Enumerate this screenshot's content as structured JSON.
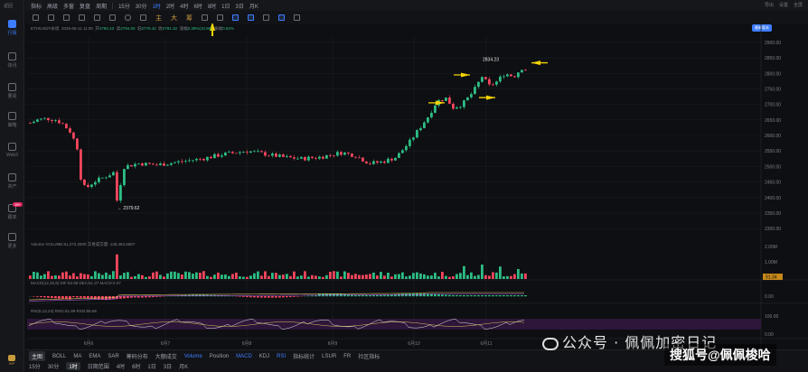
{
  "sidebar": {
    "top_label": "返回",
    "items": [
      {
        "label": "行情",
        "icon": "chart-bar-icon",
        "active": true
      },
      {
        "label": "快讯",
        "icon": "news-icon"
      },
      {
        "label": "要闻",
        "icon": "newspaper-icon"
      },
      {
        "label": "策略",
        "icon": "strategy-icon"
      },
      {
        "label": "Web3",
        "icon": "web3-icon"
      },
      {
        "label": "资产",
        "icon": "wallet-icon"
      },
      {
        "label": "跟单",
        "icon": "copy-trade-icon",
        "badge": "99+"
      },
      {
        "label": "更多",
        "icon": "grid-icon"
      }
    ],
    "vip_label": "VIP"
  },
  "toolbar": {
    "items": [
      "指标",
      "高级",
      "多窗",
      "复盘",
      "周期",
      "15分",
      "30分",
      "1时",
      "2时",
      "4时",
      "6时",
      "8时",
      "1日",
      "3日",
      "月K"
    ],
    "active": "1时"
  },
  "drawbar": {
    "text_tools": [
      "主",
      "大",
      "筹"
    ]
  },
  "right_tools": [
    "导出",
    "设置",
    "全屏"
  ],
  "download_btn": "最新版本",
  "legend": {
    "symbol": "ETH/USDT永续",
    "time": "2025-06-11 11:00",
    "open_label": "开",
    "open": "2780.43",
    "high_label": "高",
    "high": "2794.00",
    "low_label": "低",
    "low": "2779.42",
    "close_label": "收",
    "close": "2791.32",
    "change_label": "涨幅",
    "change": "0.39%(10.90)",
    "amp_label": "振幅",
    "amp": "0.52%"
  },
  "chart_data": {
    "type": "candlestick",
    "price_ticks": [
      "2900.00",
      "2850.00",
      "2800.00",
      "2750.00",
      "2700.00",
      "2650.00",
      "2600.00",
      "2550.00",
      "2500.00",
      "2450.00",
      "2400.00",
      "2350.00",
      "2300.00"
    ],
    "x_ticks": [
      "6月6",
      "6月7",
      "6月8",
      "6月9",
      "6月10",
      "6月11"
    ],
    "high_annotation": "2834.23",
    "low_annotation": "2379.62",
    "volume_ticks": [
      "2.00M",
      "1.00M"
    ],
    "volume_legend": "Volume  VOLUME:61,273.2500  交易成交量: 138,462.6687",
    "macd_legend": "MACD(12,26,9)  DIF:63.99  DEA:61.37  MACD:0.07",
    "macd_tick": "0.00",
    "rsi_legend": "RSI(6,12,24)  RSI1:61.99  RSI2:56.86",
    "rsi_ticks": [
      "100.00",
      "0.00"
    ],
    "price_tag": "91.34",
    "ylim": [
      2280,
      2920
    ]
  },
  "bottombar": {
    "row1": [
      "主图",
      "BOLL",
      "MA",
      "EMA",
      "SAR",
      "筹码分布",
      "大额成交",
      "Volume",
      "Position",
      "MACD",
      "KDJ",
      "RSI",
      "指标统计",
      "LSUR",
      "FR",
      "社区指标"
    ],
    "row1_selected": "主图",
    "row1_blue": [
      "Volume",
      "MACD",
      "RSI"
    ],
    "row2": [
      "15分",
      "30分",
      "1时",
      "4时",
      "6时",
      "1日",
      "3日",
      "月K"
    ],
    "row2_selected": "1时",
    "sub_label": "日期范围"
  },
  "watermark": {
    "line1": "公众号 · 佩佩加密日记",
    "line2": "搜狐号@佩佩梭哈"
  },
  "colors": {
    "up": "#2ebd85",
    "down": "#f6465d",
    "accent": "#3d7dff",
    "arrow": "#f5d300"
  }
}
